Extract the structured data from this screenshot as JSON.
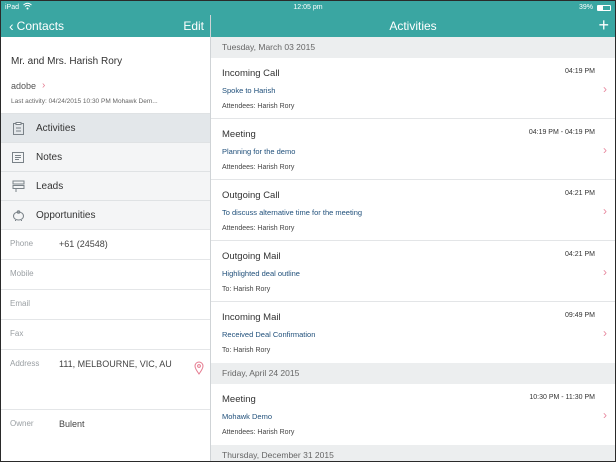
{
  "status_bar": {
    "device": "iPad",
    "wifi_icon": "wifi-icon",
    "time": "12:05 pm",
    "battery": "39%",
    "battery_level": 0.39
  },
  "left_nav": {
    "back_label": "Contacts",
    "edit_label": "Edit"
  },
  "right_nav": {
    "title": "Activities",
    "add_icon": "+"
  },
  "contact": {
    "name": "Mr. and Mrs. Harish Rory",
    "company": "adobe",
    "last_activity": "Last activity: 04/24/2015 10:30 PM Mohawk Dem..."
  },
  "menu": [
    {
      "label": "Activities",
      "icon": "clipboard-icon",
      "active": true
    },
    {
      "label": "Notes",
      "icon": "notes-icon",
      "active": false
    },
    {
      "label": "Leads",
      "icon": "signpost-icon",
      "active": false
    },
    {
      "label": "Opportunities",
      "icon": "piggy-bank-icon",
      "active": false
    }
  ],
  "fields": {
    "phone": {
      "label": "Phone",
      "value": "+61 (24548)"
    },
    "mobile": {
      "label": "Mobile",
      "value": ""
    },
    "email": {
      "label": "Email",
      "value": ""
    },
    "fax": {
      "label": "Fax",
      "value": ""
    },
    "address": {
      "label": "Address",
      "value": "111, MELBOURNE, VIC, AU"
    },
    "owner": {
      "label": "Owner",
      "value": "Bulent"
    }
  },
  "sections": [
    {
      "date": "Tuesday, March 03 2015",
      "activities": [
        {
          "type": "Incoming Call",
          "time": "04:19 PM",
          "subject": "Spoke to Harish",
          "attendees": "Attendees: Harish Rory"
        },
        {
          "type": "Meeting",
          "time": "04:19 PM - 04:19 PM",
          "subject": "Planning for the demo",
          "attendees": "Attendees: Harish Rory"
        },
        {
          "type": "Outgoing Call",
          "time": "04:21 PM",
          "subject": "To discuss alternative time for the meeting",
          "attendees": "Attendees: Harish Rory"
        },
        {
          "type": "Outgoing Mail",
          "time": "04:21 PM",
          "subject": "Highlighted deal outline",
          "attendees": "To: Harish Rory"
        },
        {
          "type": "Incoming Mail",
          "time": "09:49 PM",
          "subject": "Received Deal Confirmation",
          "attendees": "To: Harish Rory"
        }
      ]
    },
    {
      "date": "Friday, April 24 2015",
      "activities": [
        {
          "type": "Meeting",
          "time": "10:30 PM - 11:30 PM",
          "subject": "Mohawk Demo",
          "attendees": "Attendees: Harish Rory"
        }
      ]
    },
    {
      "date": "Thursday, December 31 2015",
      "activities": []
    }
  ]
}
